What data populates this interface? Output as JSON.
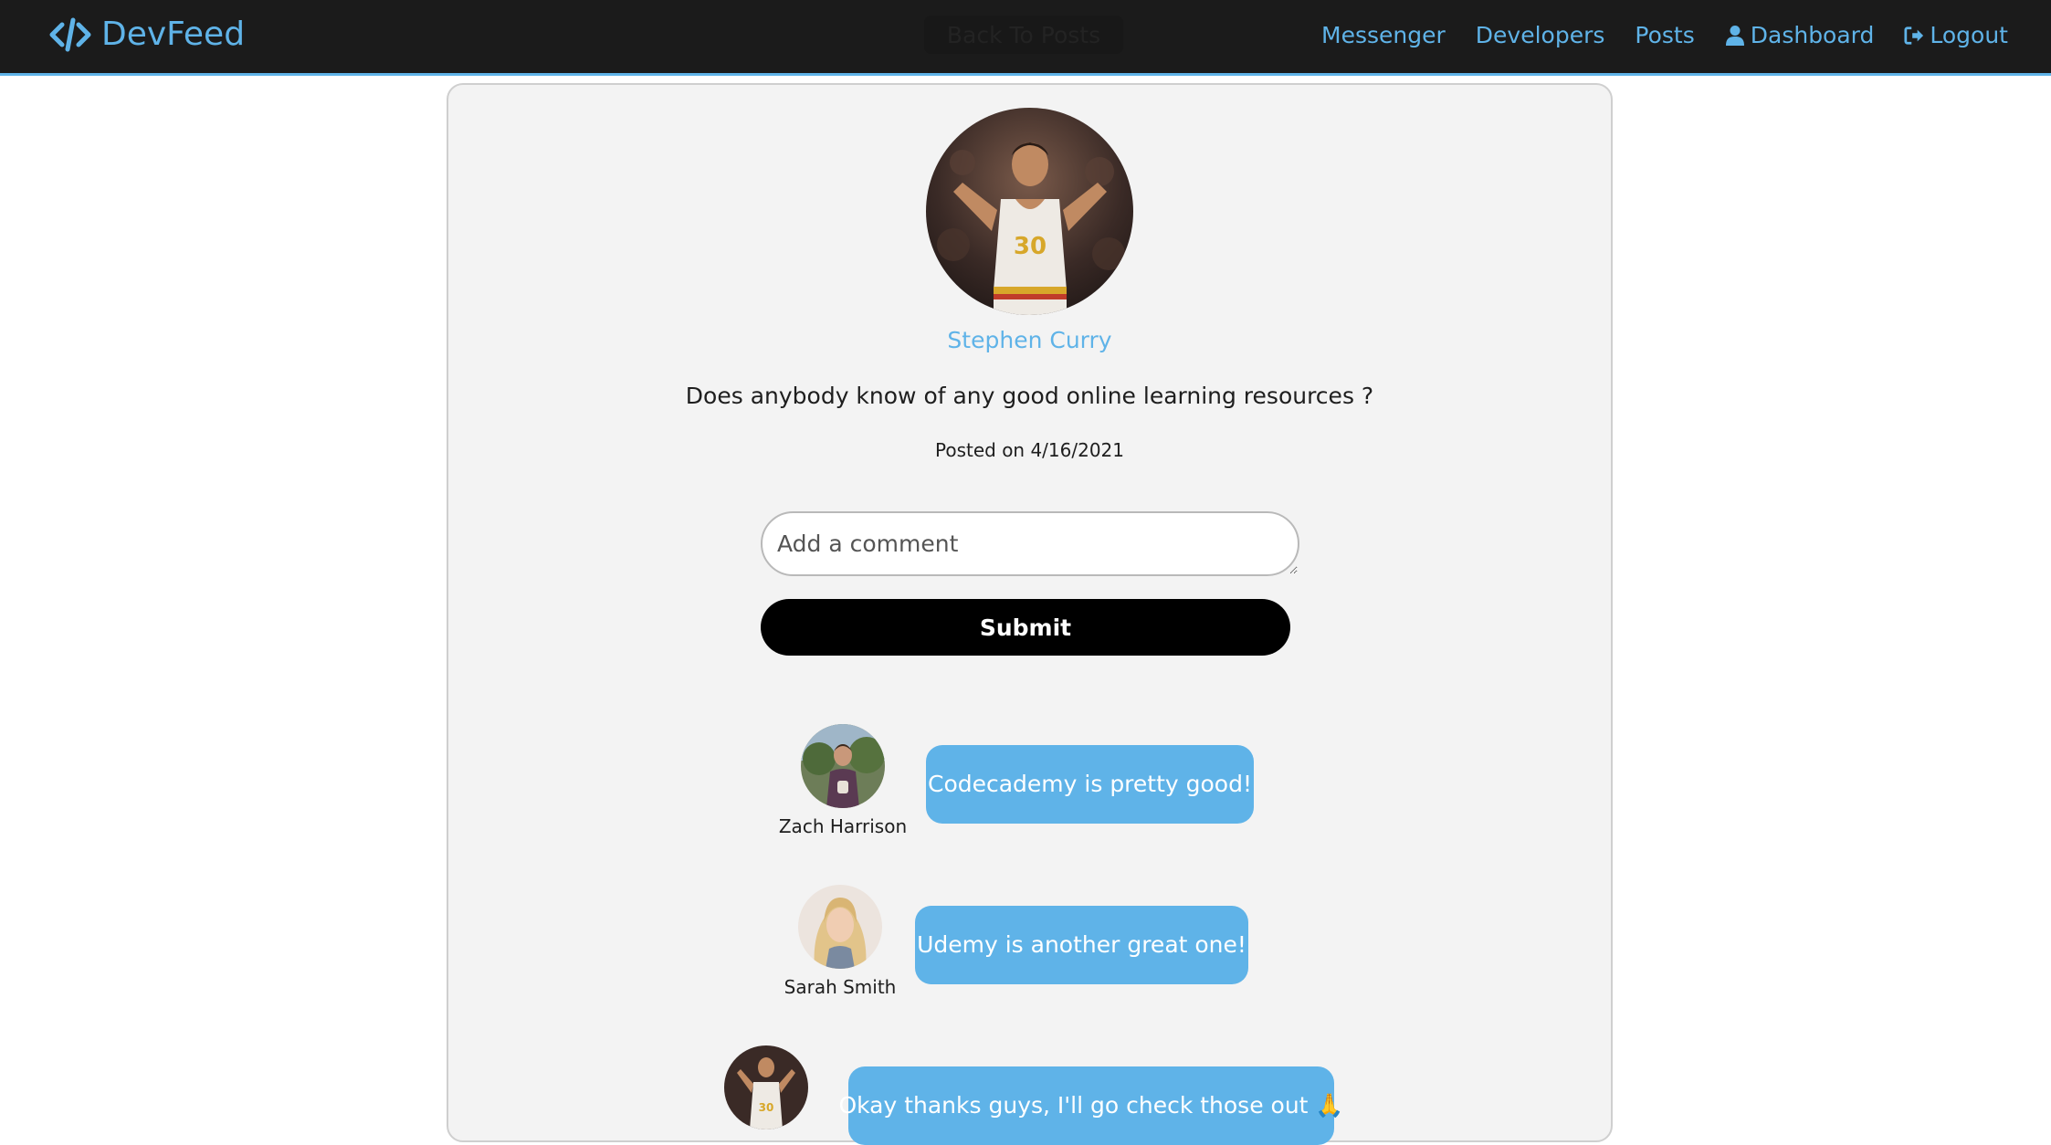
{
  "nav": {
    "brand": "DevFeed",
    "back_label": "Back To Posts",
    "links": {
      "messenger": "Messenger",
      "developers": "Developers",
      "posts": "Posts",
      "dashboard": "Dashboard",
      "logout": "Logout"
    },
    "icons": {
      "brand": "code-icon",
      "dashboard": "user-icon",
      "logout": "sign-out-icon"
    }
  },
  "post": {
    "author": "Stephen Curry",
    "text": "Does anybody know of any good online learning resources ?",
    "date": "Posted on 4/16/2021"
  },
  "comment_form": {
    "placeholder": "Add a comment",
    "submit_label": "Submit"
  },
  "comments": [
    {
      "name": "Zach Harrison",
      "text": "Codecademy is pretty good!"
    },
    {
      "name": "Sarah Smith",
      "text": "Udemy is another great one!"
    },
    {
      "name": "",
      "text": "Okay thanks guys, I'll go check those out 🙏"
    }
  ],
  "colors": {
    "accent": "#5fb3e8",
    "navbar": "#1b1b1b",
    "card": "#f3f3f3",
    "button": "#000000"
  }
}
